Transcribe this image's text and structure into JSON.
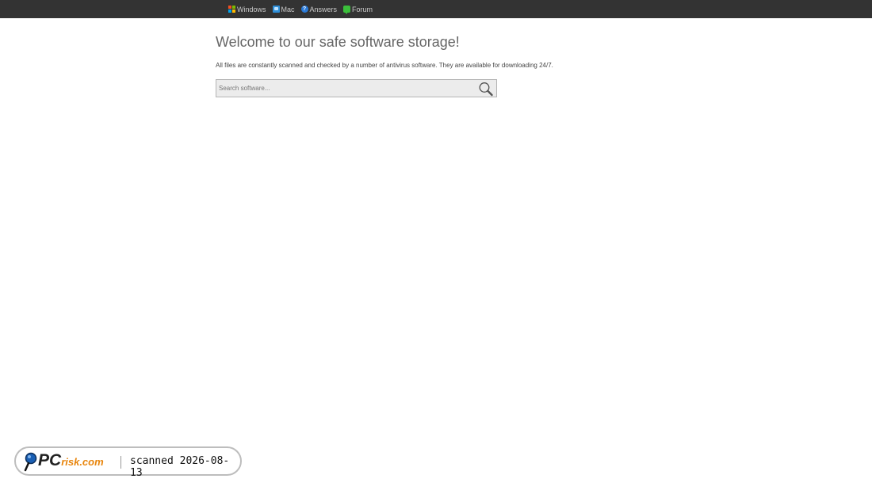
{
  "nav": {
    "items": [
      {
        "label": "Windows",
        "icon": "windows-icon"
      },
      {
        "label": "Mac",
        "icon": "mac-icon"
      },
      {
        "label": "Answers",
        "icon": "answers-icon"
      },
      {
        "label": "Forum",
        "icon": "forum-icon"
      }
    ]
  },
  "main": {
    "title": "Welcome to our safe software storage!",
    "description": "All files are constantly scanned and checked by a number of antivirus software. They are available for downloading 24/7.",
    "search": {
      "placeholder": "Search software...",
      "value": ""
    }
  },
  "badge": {
    "logo_pc": "PC",
    "logo_risk": "risk.com",
    "scan_text": "scanned 2026-08-13"
  },
  "colors": {
    "topbar": "#333333",
    "nav_text": "#c8c8c8",
    "heading": "#666666",
    "logo_accent": "#e8850c",
    "logo_blue": "#1a5fb4"
  }
}
